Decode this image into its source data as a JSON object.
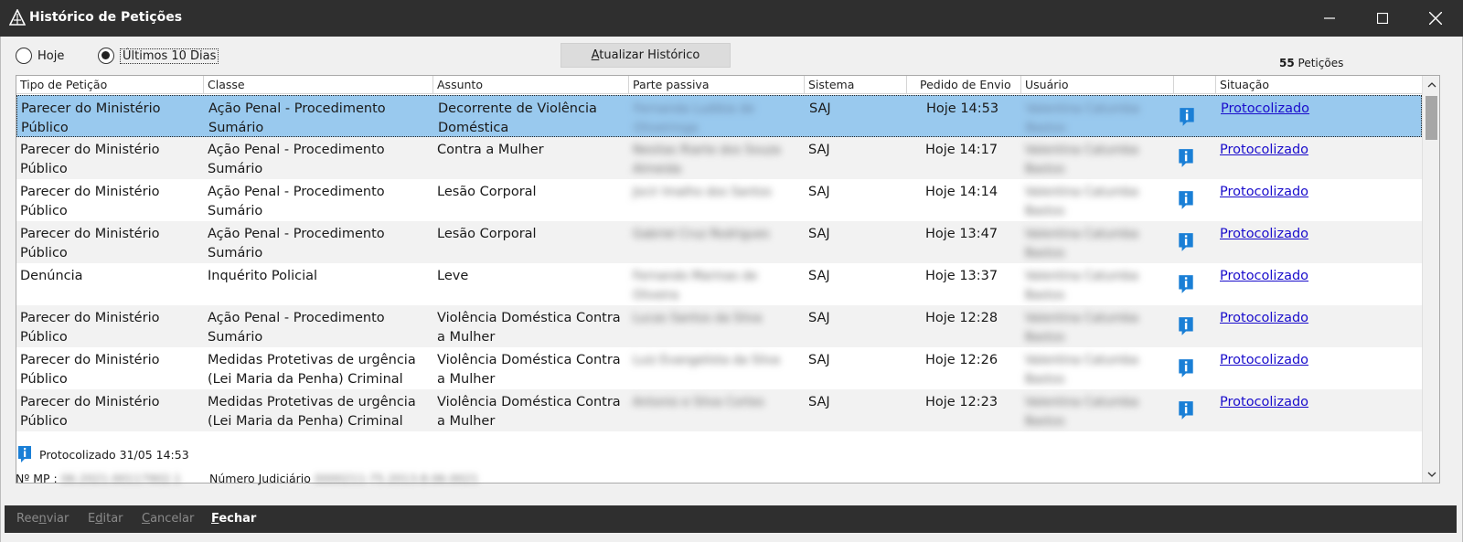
{
  "window": {
    "title": "Histórico de Petições",
    "icon": "app-logo-icon",
    "controls": [
      "minimize-icon",
      "maximize-icon",
      "close-icon"
    ]
  },
  "filters": {
    "today_label": "Hoje",
    "last10_label": "Últimos 10 Dias",
    "selected": "Últimos 10 Dias"
  },
  "update_button": {
    "underline": "A",
    "rest": "tualizar Histórico"
  },
  "count": {
    "number": "55",
    "label": "Petições"
  },
  "table": {
    "columns": [
      "Tipo de Petição",
      "Classe",
      "Assunto",
      "Parte passiva",
      "Sistema",
      "Pedido de Envio",
      "Usuário",
      "",
      "Situação"
    ],
    "rows": [
      {
        "tipo": "Parecer do Ministério Público",
        "classe": "Ação Penal - Procedimento Sumário",
        "assunto": "Decorrente de Violência Doméstica",
        "parte": "Fernanda Ludibia de Oliveiringa",
        "sistema": "SAJ",
        "pedido": "Hoje 14:53",
        "usuario": "Valentina Catumba Bastos",
        "situacao": "Protocolizado",
        "selected": true
      },
      {
        "tipo": "Parecer do Ministério Público",
        "classe": "Ação Penal - Procedimento Sumário",
        "assunto": "Contra a Mulher",
        "parte": "Nesitas Riarte dos Souza Almeida",
        "sistema": "SAJ",
        "pedido": "Hoje 14:17",
        "usuario": "Valentina Catumba Bastos",
        "situacao": "Protocolizado",
        "selected": false
      },
      {
        "tipo": "Parecer do Ministério Público",
        "classe": "Ação Penal - Procedimento Sumário",
        "assunto": "Lesão Corporal",
        "parte": "Jocir Imalho dos Santos",
        "sistema": "SAJ",
        "pedido": "Hoje 14:14",
        "usuario": "Valentina Catumba Bastos",
        "situacao": "Protocolizado",
        "selected": false
      },
      {
        "tipo": "Parecer do Ministério Público",
        "classe": "Ação Penal - Procedimento Sumário",
        "assunto": "Lesão Corporal",
        "parte": "Gabriel Cruz Rodrigues",
        "sistema": "SAJ",
        "pedido": "Hoje 13:47",
        "usuario": "Valentina Catumba Bastos",
        "situacao": "Protocolizado",
        "selected": false
      },
      {
        "tipo": "Denúncia",
        "classe": "Inquérito Policial",
        "assunto": "Leve",
        "parte": "Fernando Marinas de Oliveira",
        "sistema": "SAJ",
        "pedido": "Hoje 13:37",
        "usuario": "Valentina Catumba Bastos",
        "situacao": "Protocolizado",
        "selected": false
      },
      {
        "tipo": "Parecer do Ministério Público",
        "classe": "Ação Penal - Procedimento Sumário",
        "assunto": "Violência Doméstica Contra a Mulher",
        "parte": "Lucas Santos da Silva",
        "sistema": "SAJ",
        "pedido": "Hoje 12:28",
        "usuario": "Valentina Catumba Bastos",
        "situacao": "Protocolizado",
        "selected": false
      },
      {
        "tipo": "Parecer do Ministério Público",
        "classe": "Medidas Protetivas de urgência (Lei Maria da Penha) Criminal",
        "assunto": "Violência Doméstica Contra a Mulher",
        "parte": "Luiz Evangelista da Silva",
        "sistema": "SAJ",
        "pedido": "Hoje 12:26",
        "usuario": "Valentina Catumba Bastos",
        "situacao": "Protocolizado",
        "selected": false
      },
      {
        "tipo": "Parecer do Ministério Público",
        "classe": "Medidas Protetivas de urgência (Lei Maria da Penha) Criminal",
        "assunto": "Violência Doméstica Contra a Mulher",
        "parte": "Antonio e Silva Cortes",
        "sistema": "SAJ",
        "pedido": "Hoje 12:23",
        "usuario": "Valentina Catumba Bastos",
        "situacao": "Protocolizado",
        "selected": false
      }
    ]
  },
  "status_footer": {
    "text": "Protocolizado 31/05 14:53"
  },
  "fields": {
    "mp_label": "Nº MP :",
    "mp_value": "06.2021.00117902.1",
    "judicial_label": "Número Judiciário",
    "judicial_value": "0000211-75.2013.8.06.0021"
  },
  "bottom_actions": [
    {
      "pre": "Ree",
      "u": "n",
      "post": "viar"
    },
    {
      "pre": "E",
      "u": "d",
      "post": "itar"
    },
    {
      "pre": "",
      "u": "C",
      "post": "ancelar"
    },
    {
      "pre": "",
      "u": "F",
      "post": "echar"
    }
  ],
  "colors": {
    "titlebar": "#2f2f2f",
    "selected_row": "#99c9ee",
    "alt_row": "#f2f2f2",
    "link": "#1a0dcc",
    "info_icon": "#1a7fd6"
  }
}
